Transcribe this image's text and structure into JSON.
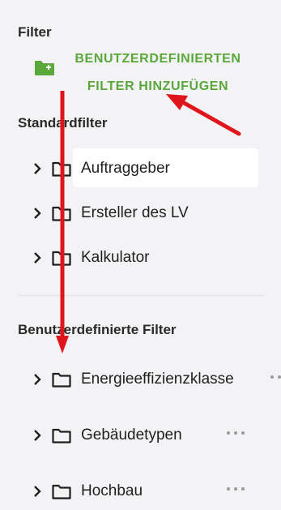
{
  "sidebar": {
    "filter_heading": "Filter",
    "add_filter": {
      "line1": "BENUTZERDEFINIERTEN",
      "line2": "FILTER HINZUFÜGEN",
      "icon": "folder-plus-icon"
    },
    "standard_heading": "Standardfilter",
    "standard_items": [
      {
        "label": "Auftraggeber"
      },
      {
        "label": "Ersteller des LV"
      },
      {
        "label": "Kalkulator"
      }
    ],
    "custom_heading": "Benutzerdefinierte Filter",
    "custom_items": [
      {
        "label": "Energieeffizienzklasse"
      },
      {
        "label": "Gebäudetypen"
      },
      {
        "label": "Hochbau"
      }
    ]
  },
  "colors": {
    "accent_green": "#5aa83a",
    "annotation_red": "#e0141b",
    "background": "#f3f3f5"
  }
}
